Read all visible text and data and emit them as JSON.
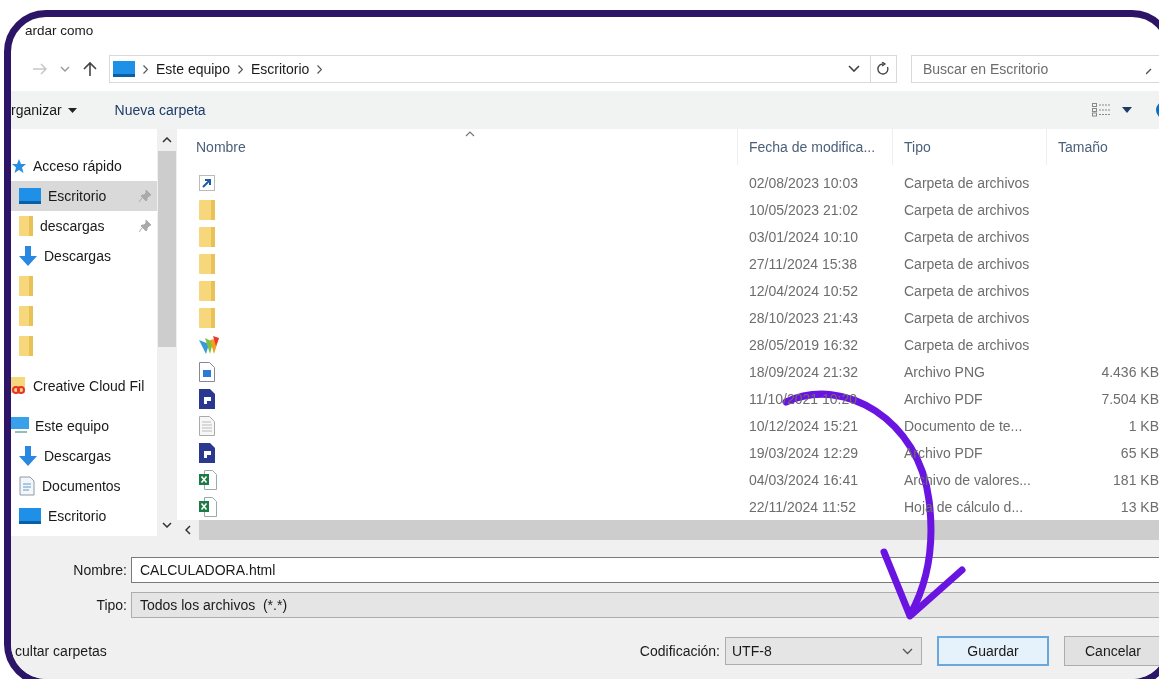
{
  "window": {
    "title": "ardar como"
  },
  "address_bar": {
    "path": [
      "Este equipo",
      "Escritorio"
    ]
  },
  "search": {
    "placeholder": "Buscar en Escritorio"
  },
  "toolbar": {
    "organize": "rganizar",
    "new_folder": "Nueva carpeta"
  },
  "nav_pane": {
    "sections": [
      {
        "kind": "star",
        "label": "Acceso rápido",
        "children": [
          {
            "kind": "desktop",
            "label": "Escritorio",
            "selected": true,
            "pinned": true
          },
          {
            "kind": "folder",
            "label": "descargas",
            "selected": false,
            "pinned": true
          },
          {
            "kind": "download",
            "label": "Descargas",
            "selected": false,
            "pinned": false
          },
          {
            "kind": "folder",
            "selected": false,
            "pinned": false
          },
          {
            "kind": "folder",
            "selected": false,
            "pinned": false
          },
          {
            "kind": "folder",
            "selected": false,
            "pinned": false
          }
        ]
      },
      {
        "kind": "cloud",
        "label": "Creative Cloud Fil"
      },
      {
        "kind": "pc",
        "label": "Este equipo",
        "children": [
          {
            "kind": "download",
            "label": "Descargas",
            "selected": false,
            "pinned": false
          },
          {
            "kind": "document",
            "label": "Documentos",
            "selected": false,
            "pinned": false
          },
          {
            "kind": "desktop",
            "label": "Escritorio",
            "selected": false,
            "pinned": false
          }
        ]
      }
    ]
  },
  "file_list": {
    "columns": [
      "Nombre",
      "Fecha de modifica...",
      "Tipo",
      "Tamaño"
    ],
    "rows": [
      {
        "kind": "shortcut",
        "date": "02/08/2023 10:03",
        "type": "Carpeta de archivos"
      },
      {
        "kind": "folder",
        "date": "10/05/2023 21:02",
        "type": "Carpeta de archivos"
      },
      {
        "kind": "folder",
        "date": "03/01/2024 10:10",
        "type": "Carpeta de archivos"
      },
      {
        "kind": "folder",
        "date": "27/11/2024 15:38",
        "type": "Carpeta de archivos"
      },
      {
        "kind": "folder",
        "date": "12/04/2024 10:52",
        "type": "Carpeta de archivos"
      },
      {
        "kind": "folder",
        "date": "28/10/2023 21:43",
        "type": "Carpeta de archivos"
      },
      {
        "kind": "app",
        "date": "28/05/2019 16:32",
        "type": "Carpeta de archivos"
      },
      {
        "kind": "image",
        "date": "18/09/2024 21:32",
        "type": "Archivo PNG",
        "size": "4.436 KB"
      },
      {
        "kind": "pdf",
        "date": "11/10/2021 10:20",
        "type": "Archivo PDF",
        "size": "7.504 KB"
      },
      {
        "kind": "text",
        "date": "10/12/2024 15:21",
        "type": "Documento de te...",
        "size": "1 KB"
      },
      {
        "kind": "pdf",
        "date": "19/03/2024 12:29",
        "type": "Archivo PDF",
        "size": "65 KB"
      },
      {
        "kind": "sheet",
        "date": "04/03/2024 16:41",
        "type": "Archivo de valores...",
        "size": "181 KB"
      },
      {
        "kind": "sheet",
        "date": "22/11/2024 11:52",
        "type": "Hoja de cálculo d...",
        "size": "13 KB"
      }
    ]
  },
  "form": {
    "name_label": "Nombre:",
    "name_value": "CALCULADORA.html",
    "type_label": "Tipo:",
    "type_value": "Todos los archivos  (*.*)"
  },
  "footer": {
    "hide_folders": "cultar carpetas",
    "encoding_label": "Codificación:",
    "encoding_value": "UTF-8",
    "buttons": [
      {
        "label": "Guardar",
        "default": true
      },
      {
        "label": "Cancelar",
        "default": false
      }
    ]
  }
}
